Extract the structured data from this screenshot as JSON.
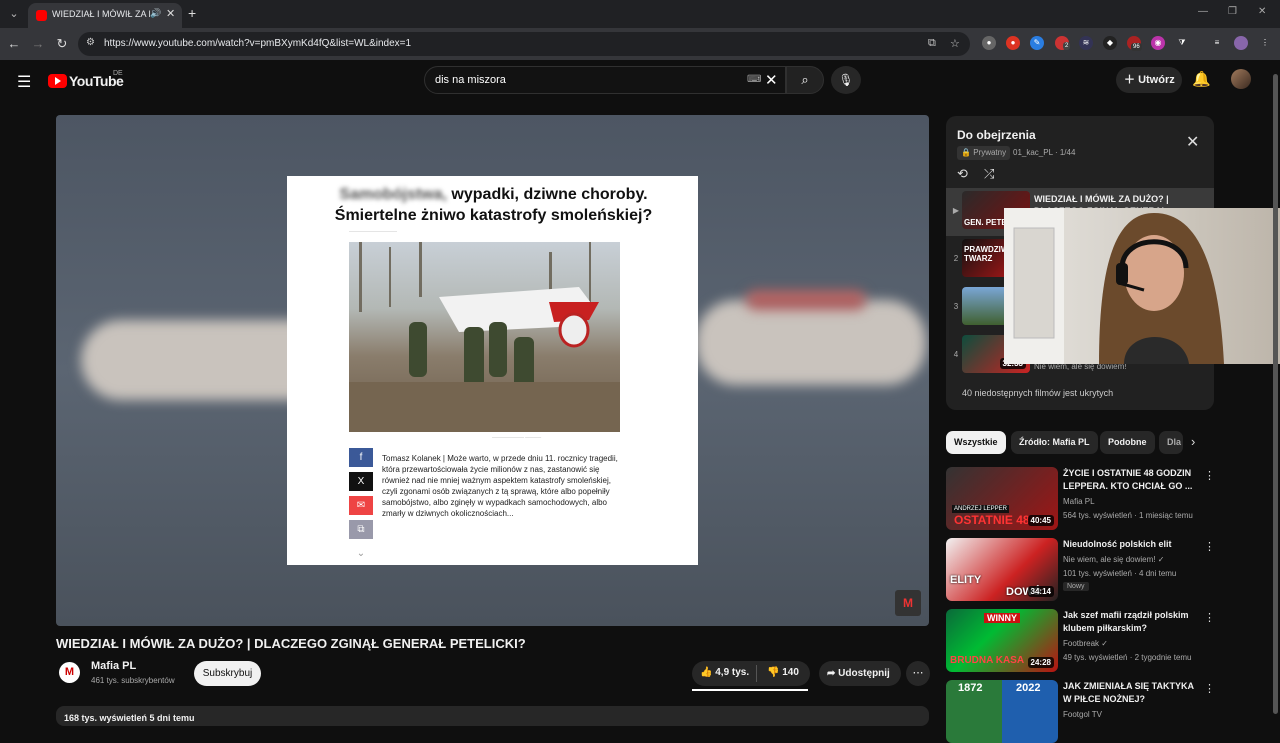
{
  "browser": {
    "tab_title": "WIEDZIAŁ I MÓWIŁ ZA DUŻO",
    "url": "https://www.youtube.com/watch?v=pmBXymKd4fQ&list=WL&index=1",
    "extension_badges": {
      "ext3": "2",
      "ext5": "96"
    }
  },
  "header": {
    "logo": "YouTube",
    "country": "DE",
    "search_value": "dis na miszora",
    "create_label": "Utwórz"
  },
  "video": {
    "article": {
      "title_blurred": "Samobójstwa,",
      "title_rest": "wypadki, dziwne choroby.",
      "title_line2": "Śmiertelne żniwo katastrofy smoleńskiej?",
      "body": "Tomasz Kolanek | Może warto, w przede dniu 11. rocznicy tragedii, która przewartościowała życie milionów z nas, zastanowić się również nad nie mniej ważnym aspektem katastrofy smoleńskiej, czyli zgonami osób związanych z tą sprawą, które albo popełniły samobójstwo, albo zginęły w wypadkach samochodowych, albo zmarły w dziwnych okolicznościach..."
    },
    "title": "WIEDZIAŁ I MÓWIŁ ZA DUŻO? | DLACZEGO ZGINĄŁ GENERAŁ PETELICKI?",
    "channel": "Mafia PL",
    "subscribers": "461 tys. subskrybentów",
    "subscribe_label": "Subskrybuj",
    "likes": "4,9 tys.",
    "dislikes": "140",
    "share_label": "Udostępnij",
    "description": "168 tys. wyświetleń  5 dni temu"
  },
  "playlist": {
    "title": "Do obejrzenia",
    "privacy": "Prywatny",
    "owner": "01_kac_PL · 1/44",
    "items": [
      {
        "index": "▶",
        "title": "WIEDZIAŁ I MÓWIŁ ZA DUŻO? | DLACZEGO ZGINĄŁ GENERAŁ",
        "channel": "",
        "thumb_text": "GEN. PETE"
      },
      {
        "index": "2",
        "title": "",
        "channel": "",
        "thumb_text": "PRAWDZIWA TWARZ"
      },
      {
        "index": "3",
        "title": "",
        "channel": "",
        "thumb_text": ""
      },
      {
        "index": "4",
        "title": "",
        "channel": "Nie wiem, ale się dowiem!",
        "thumb_text": "",
        "duration": "32:33"
      }
    ],
    "hidden_note": "40 niedostępnych filmów jest ukrytych"
  },
  "chips": [
    "Wszystkie",
    "Źródło: Mafia PL",
    "Podobne",
    "Dla"
  ],
  "recommendations": [
    {
      "title": "ŻYCIE I OSTATNIE 48 GODZIN LEPPERA. KTO CHCIAŁ GO ...",
      "channel": "Mafia PL",
      "meta": "564 tys. wyświetleń · 1 miesiąc temu",
      "duration": "40:45",
      "thumb_text": "OSTATNIE 48",
      "thumb_label": "ANDRZEJ LEPPER",
      "badge": ""
    },
    {
      "title": "Nieudolność polskich elit",
      "channel": "Nie wiem, ale się dowiem! ✓",
      "meta": "101 tys. wyświetleń · 4 dni temu",
      "duration": "34:14",
      "thumb_text": "ELITY",
      "thumb_label": "DOWÓ",
      "badge": "Nowy"
    },
    {
      "title": "Jak szef mafii rządził polskim klubem piłkarskim?",
      "channel": "Footbreak ✓",
      "meta": "49 tys. wyświetleń · 2 tygodnie temu",
      "duration": "24:28",
      "thumb_text": "BRUDNA KASA",
      "thumb_label": "WINNY",
      "badge": ""
    },
    {
      "title": "JAK ZMIENIAŁA SIĘ TAKTYKA W PIŁCE NOŻNEJ?",
      "channel": "Footgol TV",
      "meta": "",
      "duration": "",
      "thumb_text": "1872",
      "thumb_label": "2022",
      "badge": ""
    }
  ],
  "colors": {
    "accent": "#ff0000",
    "background": "#0f0f0f",
    "surface": "#272727"
  }
}
